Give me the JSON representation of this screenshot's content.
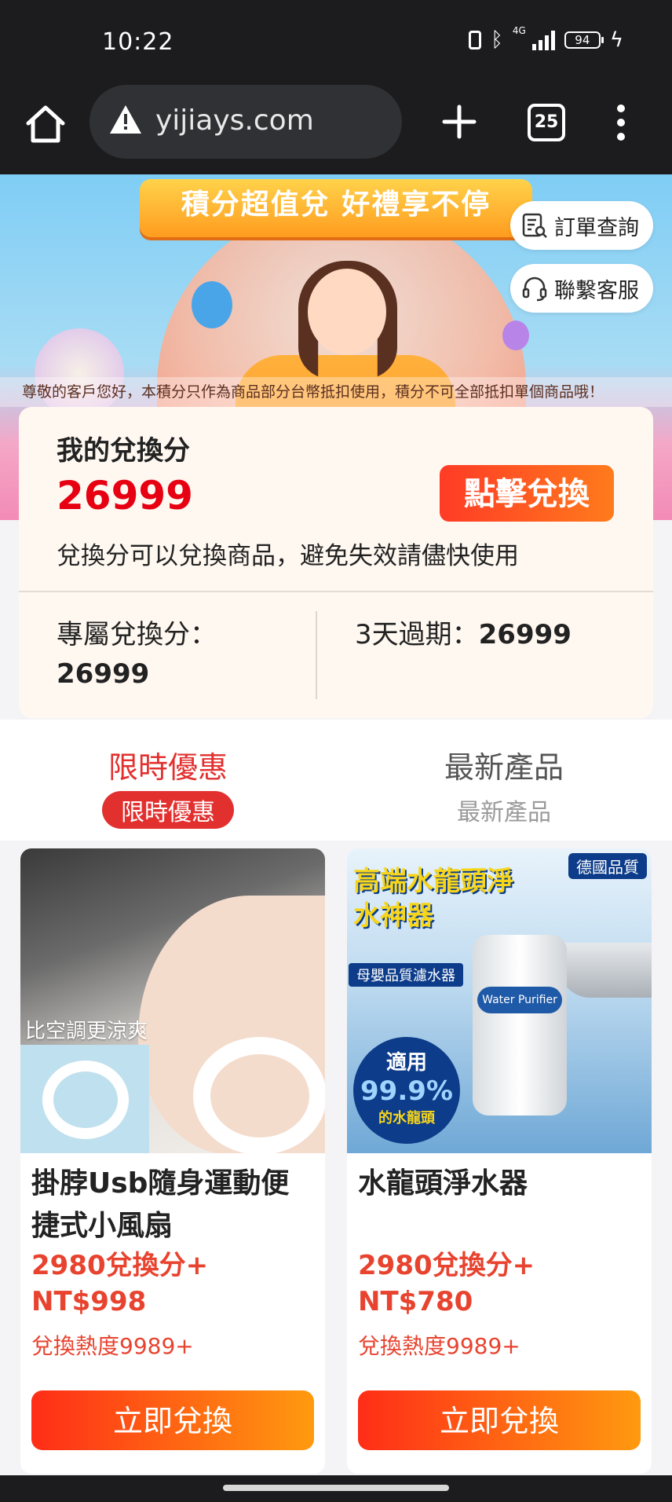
{
  "status_bar": {
    "time": "10:22",
    "network": "4G",
    "battery": "94",
    "icons": [
      "vibrate-icon",
      "bluetooth-icon",
      "signal-icon",
      "battery-icon",
      "charging-icon"
    ]
  },
  "browser": {
    "url": "yijiays.com",
    "tab_count": "25",
    "icons": [
      "home-icon",
      "not-secure-warning-icon",
      "new-tab-plus-icon",
      "tab-switcher-icon",
      "more-menu-icon"
    ]
  },
  "banner": {
    "title": "積分超值兌 好禮享不停",
    "order_query_label": "訂單查詢",
    "customer_service_label": "聯繫客服",
    "notice": "尊敬的客戶您好，本積分只作為商品部分台幣抵扣使用，積分不可全部抵扣單個商品哦！"
  },
  "points_card": {
    "title": "我的兌換分",
    "value": "26999",
    "redeem_button": "點擊兌換",
    "description": "兌換分可以兌換商品，避免失效請儘快使用",
    "exclusive_label": "專屬兌換分：",
    "exclusive_value": "26999",
    "expire_label": "3天過期：",
    "expire_value": "26999"
  },
  "tabs": [
    {
      "label": "限時優惠",
      "sub_label": "限時優惠",
      "active": true
    },
    {
      "label": "最新產品",
      "sub_label": "最新產品",
      "active": false
    }
  ],
  "products": [
    {
      "name": "掛脖Usb隨身運動便捷式小風扇",
      "price_points": "2980兌換分+",
      "price_ntd": "NT$998",
      "heat": "兌換熱度9989+",
      "button": "立即兌換",
      "image_caption": "比空調更涼爽"
    },
    {
      "name": "水龍頭淨水器",
      "price_points": "2980兌換分+",
      "price_ntd": "NT$780",
      "heat": "兌換熱度9989+",
      "button": "立即兌換",
      "image_title": "高端水龍頭淨水神器",
      "image_badge": "德國品質",
      "image_strip": "母嬰品質濾水器",
      "image_filter_label": "Water Purifier",
      "image_circle_line1": "適用",
      "image_circle_line2": "99.9%",
      "image_circle_line3": "的水龍頭"
    }
  ],
  "colors": {
    "accent_red": "#e60012",
    "button_gradient_start": "#ff2d17",
    "button_gradient_end": "#ff9a0f",
    "tab_active": "#e2302f",
    "card_bg": "#fff8f1"
  }
}
